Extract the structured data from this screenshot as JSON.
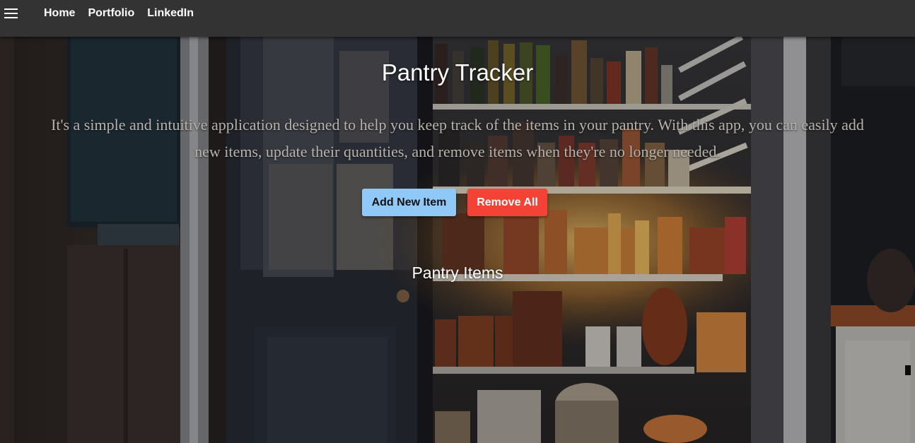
{
  "nav": {
    "menu_icon": "hamburger-menu-icon",
    "links": [
      {
        "label": "Home"
      },
      {
        "label": "Portfolio"
      },
      {
        "label": "LinkedIn"
      }
    ]
  },
  "hero": {
    "title": "Pantry Tracker",
    "description": "It's a simple and intuitive application designed to help you keep track of the items in your pantry. With this app, you can easily add new items, update their quantities, and remove items when they're no longer needed.",
    "background": "pantry-shelves-photo"
  },
  "actions": {
    "add_label": "Add New Item",
    "remove_label": "Remove All"
  },
  "items_section": {
    "title": "Pantry Items"
  },
  "colors": {
    "navbar": "#333333",
    "add_button": "#90c9f8",
    "remove_button": "#f44336"
  }
}
